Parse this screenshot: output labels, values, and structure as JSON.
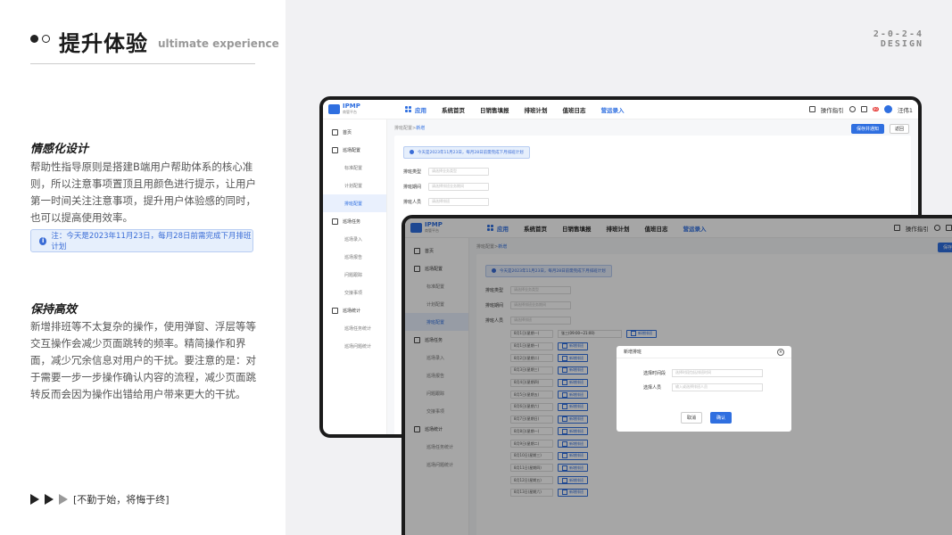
{
  "header": {
    "title_cn": "提升体验",
    "title_en": "ultimate experience",
    "year_tag": "2-0-2-4",
    "design_tag": "DESIGN"
  },
  "section1": {
    "heading": "情感化设计",
    "body": "帮助性指导原则是搭建B端用户帮助体系的核心准则，所以注意事项置顶且用颜色进行提示，让用户第一时间关注注意事项，提升用户体验感的同时，也可以提高使用效率。",
    "tip_text": "注：今天是2023年11月23日，每月28日前需完成下月排班计划"
  },
  "section2": {
    "heading": "保持高效",
    "body": "新增排班等不太复杂的操作，使用弹窗、浮层等等交互操作会减少页面跳转的频率。精简操作和界面，减少冗余信息对用户的干扰。要注意的是：对于需要一步一步操作确认内容的流程，减少页面跳转反而会因为操作出错给用户带来更大的干扰。"
  },
  "motto": "[不勤于始，将悔于终]",
  "app": {
    "logo_title": "IPMP",
    "logo_sub": "商管平台",
    "nav": [
      "应用",
      "系统首页",
      "日销售填报",
      "排班计划",
      "值班日志",
      "营运录入"
    ],
    "guide": "操作指引",
    "badge": "99",
    "user": "汪伟1",
    "breadcrumb_a": "排班配置",
    "breadcrumb_b": "新增",
    "save_btn": "保存并通知",
    "back_btn": "返回",
    "notice": "今天是2023年11月23日，每月28日前需完成下月排班计划",
    "sidebar": {
      "home": "首页",
      "group1": "巡场配置",
      "g1_items": [
        "标准配置",
        "计划配置",
        "排班配置"
      ],
      "group2": "巡场任务",
      "g2_items": [
        "巡场录入",
        "巡场报告",
        "问题跟踪",
        "交接事项"
      ],
      "group3": "巡场统计",
      "g3_items": [
        "巡场任务统计",
        "巡场问题统计"
      ]
    },
    "form": {
      "f1_label": "排班类型",
      "f1_ph": "请选择业务类型",
      "f2_label": "排班期间",
      "f2_ph": "请选择排班业务期间",
      "f3_label": "排班人员",
      "f3_ph": "请选择排班"
    },
    "dates": [
      "8月1日(星期一)",
      "8月1日(星期一)",
      "8月2日(星期二)",
      "8月3日(星期三)",
      "8月4日(星期四)",
      "8月5日(星期五)",
      "8月6日(星期六)",
      "8月7日(星期日)",
      "8月8日(星期一)",
      "8月9日(星期二)",
      "8月10日(星期三)",
      "8月11日(星期四)",
      "8月12日(星期五)",
      "8月13日(星期六)"
    ],
    "shift_value": "张三(09:00~21:00)",
    "add_shift": "新增排班",
    "modal": {
      "title": "新增排班",
      "r1_label": "选择时间段",
      "r1_ph": "选择时段包括排班时间",
      "r2_label": "选择人员",
      "r2_ph": "输入或选择排班人员",
      "cancel": "取消",
      "ok": "确认"
    }
  }
}
